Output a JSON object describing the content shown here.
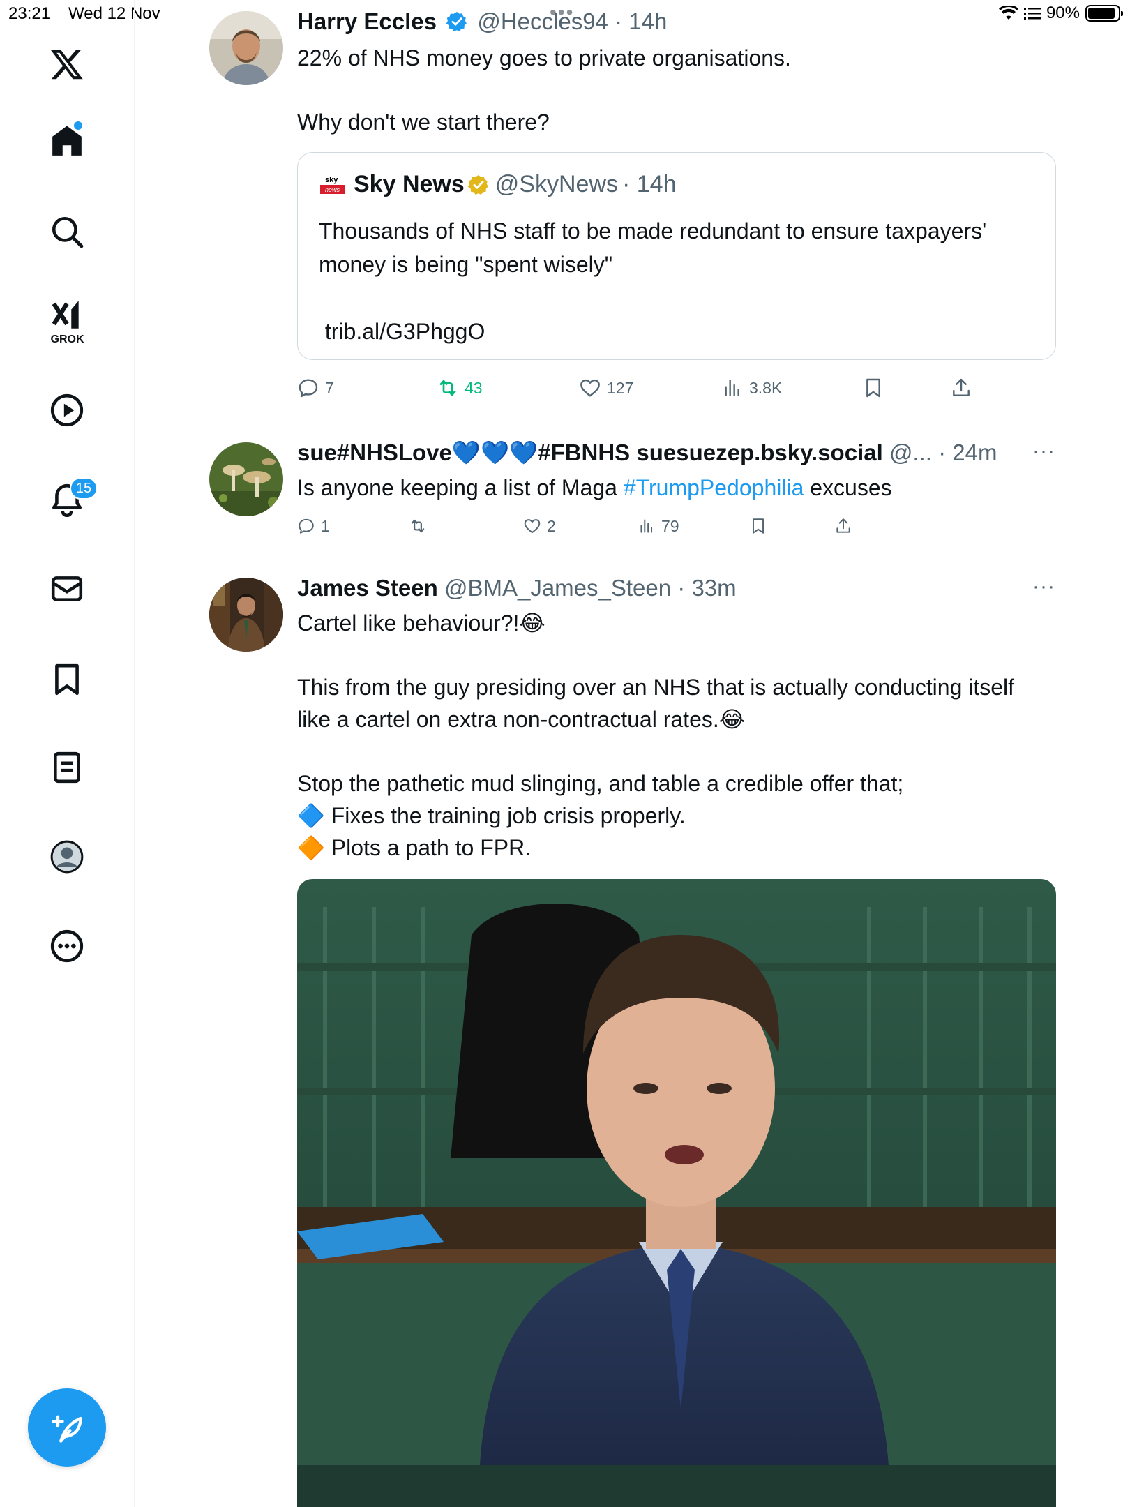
{
  "status_bar": {
    "time": "23:21",
    "date": "Wed 12 Nov",
    "battery": "90%"
  },
  "sidebar": {
    "grok_label": "GROK",
    "notifications_badge": "15"
  },
  "tweets": [
    {
      "name": "Harry Eccles",
      "handle": "@Heccles94",
      "time": "· 14h",
      "text": "22% of NHS money goes to private organisations.\n\nWhy don't we start there?",
      "quote": {
        "name": "Sky News",
        "handle": "@SkyNews",
        "time": "· 14h",
        "text": "Thousands of NHS staff to be made redundant to ensure taxpayers' money is being \"spent wisely\"\n\n trib.al/G3PhggO"
      },
      "replies": "7",
      "reposts": "43",
      "likes": "127",
      "views": "3.8K"
    },
    {
      "name": "sue#NHSLove💙💙💙#FBNHS suesuezep.bsky.social",
      "handle": "@...",
      "time": "· 24m",
      "text_before": "Is anyone keeping a list of Maga ",
      "hashtag": "#TrumpPedophilia",
      "text_after": " excuses",
      "replies": "1",
      "reposts": "",
      "likes": "2",
      "views": "79"
    },
    {
      "name": "James Steen",
      "handle": "@BMA_James_Steen",
      "time": "· 33m",
      "text": "Cartel like behaviour?!😂\n\nThis from the guy presiding over an NHS that is actually conducting itself like a cartel on extra non-contractual rates.😂\n\nStop the pathetic mud slinging, and table a credible offer that;\n🔷 Fixes the training job crisis properly.\n🔶 Plots a path to FPR."
    }
  ],
  "colors": {
    "accent": "#1d9bf0",
    "repost_active": "#00ba7c",
    "secondary_text": "#536471"
  },
  "icons": [
    "x-logo-icon",
    "home-icon",
    "search-icon",
    "grok-icon",
    "video-icon",
    "bell-icon",
    "mail-icon",
    "bookmark-icon",
    "list-icon",
    "profile-icon",
    "more-icon",
    "compose-icon",
    "reply-icon",
    "repost-icon",
    "like-icon",
    "views-icon",
    "share-icon",
    "verified-icon"
  ]
}
